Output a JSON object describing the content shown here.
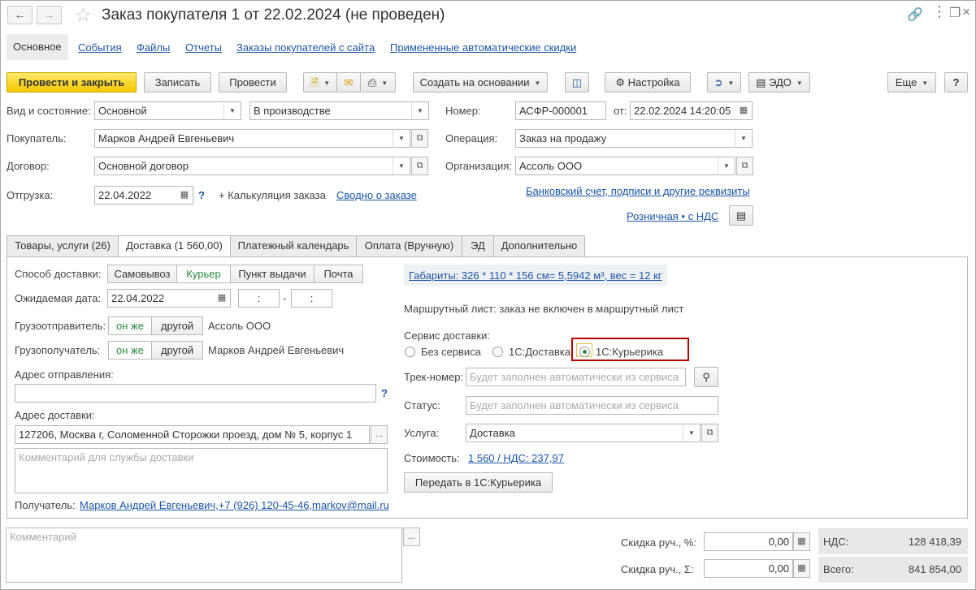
{
  "window": {
    "title": "Заказ покупателя 1 от 22.02.2024 (не проведен)"
  },
  "nav": {
    "tabs": [
      "Основное",
      "События",
      "Файлы",
      "Отчеты",
      "Заказы покупателей с сайта",
      "Примененные автоматические скидки"
    ]
  },
  "toolbar": {
    "post_close": "Провести и закрыть",
    "save": "Записать",
    "post": "Провести",
    "create_based": "Создать на основании",
    "settings": "Настройка",
    "edo": "ЭДО",
    "more": "Еще",
    "help": "?"
  },
  "header": {
    "kind_label": "Вид и состояние:",
    "kind_value": "Основной",
    "state_value": "В производстве",
    "number_label": "Номер:",
    "number_value": "АСФР-000001",
    "date_label": "от:",
    "date_value": "22.02.2024 14:20:05",
    "buyer_label": "Покупатель:",
    "buyer_value": "Марков Андрей Евгеньевич",
    "operation_label": "Операция:",
    "operation_value": "Заказ на продажу",
    "contract_label": "Договор:",
    "contract_value": "Основной договор",
    "org_label": "Организация:",
    "org_value": "Ассоль ООО",
    "shipment_label": "Отгрузка:",
    "shipment_value": "22.04.2022",
    "help_q": "?",
    "calc_label": "+ Калькуляция заказа",
    "summary_link": "Сводно о заказе",
    "bank_link": "Банковский счет, подписи и другие реквизиты",
    "price_link": "Розничная • с НДС"
  },
  "tabs": {
    "items": [
      "Товары, услуги (26)",
      "Доставка (1 560,00)",
      "Платежный календарь",
      "Оплата (Вручную)",
      "ЭД",
      "Дополнительно"
    ]
  },
  "delivery": {
    "method_label": "Способ доставки:",
    "methods": [
      "Самовывоз",
      "Курьер",
      "Пункт выдачи",
      "Почта"
    ],
    "selected_method": "Курьер",
    "expected_date_label": "Ожидаемая дата:",
    "expected_date_value": "22.04.2022",
    "time_from": ":",
    "dash": "-",
    "time_to": ":",
    "shipper_label": "Грузоотправитель:",
    "shipper_same": "он же",
    "shipper_other": "другой",
    "shipper_value": "Ассоль ООО",
    "consignee_label": "Грузополучатель:",
    "consignee_same": "он же",
    "consignee_other": "другой",
    "consignee_value": "Марков Андрей Евгеньевич",
    "from_address_label": "Адрес отправления:",
    "from_address_value": "",
    "help_q": "?",
    "to_address_label": "Адрес доставки:",
    "to_address_value": "127206, Москва г, Соломенной Сторожки проезд, дом № 5, корпус 1",
    "comment_placeholder": "Комментарий для службы доставки",
    "recipient_label": "Получатель:",
    "recipient_link": "Марков Андрей Евгеньевич,+7 (926) 120-45-46,markov@mail.ru",
    "dimensions_link": "Габариты: 326 * 110 * 156 см= 5,5942 м³, вес = 12 кг",
    "route_text": "Маршрутный лист: заказ не включен в маршрутный лист",
    "service_label": "Сервис доставки:",
    "services": [
      "Без сервиса",
      "1С:Доставка",
      "1С:Курьерика"
    ],
    "selected_service": "1С:Курьерика",
    "track_label": "Трек-номер:",
    "track_placeholder": "Будет заполнен автоматически из сервиса",
    "status_label": "Статус:",
    "status_placeholder": "Будет заполнен автоматически из сервиса",
    "service_item_label": "Услуга:",
    "service_item_value": "Доставка",
    "cost_label": "Стоимость:",
    "cost_link": "1 560 / НДС: 237,97",
    "send_button": "Передать в 1С:Курьерика"
  },
  "footer": {
    "comment_placeholder": "Комментарий",
    "discount_pct_label": "Скидка руч., %:",
    "discount_pct_value": "0,00",
    "discount_sum_label": "Скидка руч., Σ:",
    "discount_sum_value": "0,00",
    "vat_label": "НДС:",
    "vat_value": "128 418,39",
    "total_label": "Всего:",
    "total_value": "841 854,00"
  },
  "colors": {
    "primary_button": "#f5c800",
    "link": "#1a55a6",
    "highlight_frame": "#c00000",
    "active_green": "#2a8a3a"
  }
}
